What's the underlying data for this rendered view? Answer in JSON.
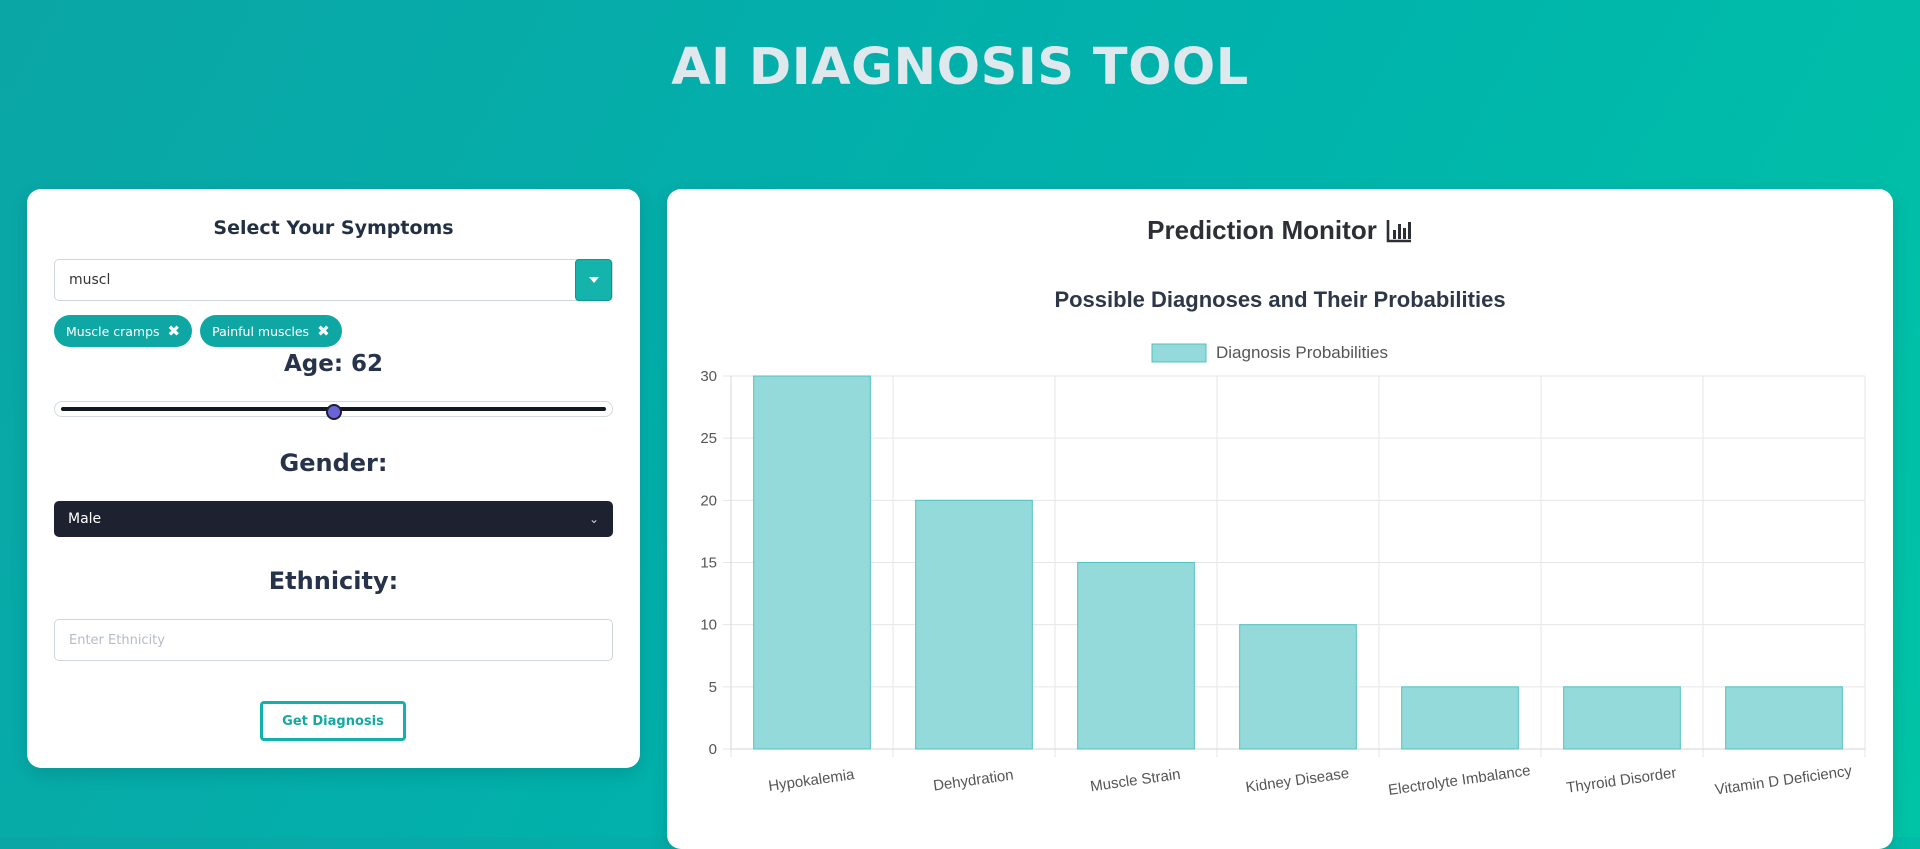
{
  "app": {
    "title": "AI DIAGNOSIS TOOL"
  },
  "symptoms": {
    "heading": "Select Your Symptoms",
    "search_value": "muscl",
    "selected": [
      {
        "label": "Muscle cramps",
        "remove_icon": "✖"
      },
      {
        "label": "Painful muscles",
        "remove_icon": "✖"
      }
    ]
  },
  "age": {
    "label": "Age: 62",
    "value": 62,
    "slider_fraction": 0.5
  },
  "gender": {
    "label": "Gender:",
    "selected": "Male"
  },
  "ethnicity": {
    "label": "Ethnicity:",
    "placeholder": "Enter Ethnicity",
    "value": ""
  },
  "actions": {
    "diagnose_label": "Get Diagnosis"
  },
  "monitor": {
    "title": "Prediction Monitor"
  },
  "colors": {
    "accent": "#14b3ab",
    "bar_fill": "#95dada",
    "bar_stroke": "#4fc0c0",
    "select_bg": "#1e2230"
  },
  "chart_data": {
    "type": "bar",
    "title": "Possible Diagnoses and Their Probabilities",
    "categories": [
      "Hypokalemia",
      "Dehydration",
      "Muscle Strain",
      "Kidney Disease",
      "Electrolyte Imbalance",
      "Thyroid Disorder",
      "Vitamin D Deficiency"
    ],
    "series": [
      {
        "name": "Diagnosis Probabilities",
        "values": [
          30,
          20,
          15,
          10,
          5,
          5,
          5
        ]
      }
    ],
    "ylim": [
      0,
      30
    ],
    "yticks": [
      "0",
      "5",
      "10",
      "15",
      "20",
      "25",
      "30"
    ],
    "xlabel": "",
    "ylabel": "",
    "grid": true,
    "legend": "top-center"
  }
}
